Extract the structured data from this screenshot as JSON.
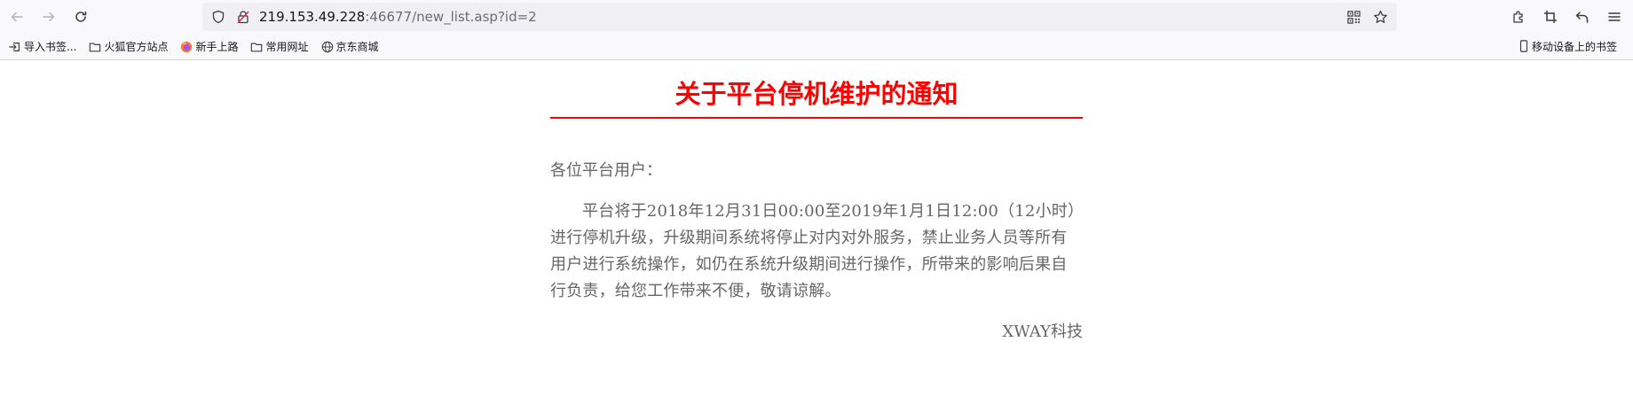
{
  "browser": {
    "url_host": "219.153.49.228",
    "url_rest": ":46677/new_list.asp?id=2",
    "bookmarks": [
      {
        "label": "导入书签...",
        "icon": "import-icon"
      },
      {
        "label": "火狐官方站点",
        "icon": "folder-icon"
      },
      {
        "label": "新手上路",
        "icon": "firefox-icon"
      },
      {
        "label": "常用网址",
        "icon": "folder-icon"
      },
      {
        "label": "京东商城",
        "icon": "globe-icon"
      }
    ],
    "mobile_bookmarks": "移动设备上的书签"
  },
  "notice": {
    "title": "关于平台停机维护的通知",
    "salutation": "各位平台用户：",
    "body": "平台将于2018年12月31日00:00至2019年1月1日12:00（12小时）进行停机升级，升级期间系统将停止对内对外服务，禁止业务人员等所有用户进行系统操作，如仍在系统升级期间进行操作，所带来的影响后果自行负责，给您工作带来不便，敬请谅解。",
    "signature": "XWAY科技"
  },
  "colors": {
    "title": "#ff0000",
    "text": "#666666",
    "chrome_bg": "#f9f9fb",
    "urlbar_bg": "#f0f0f4"
  }
}
